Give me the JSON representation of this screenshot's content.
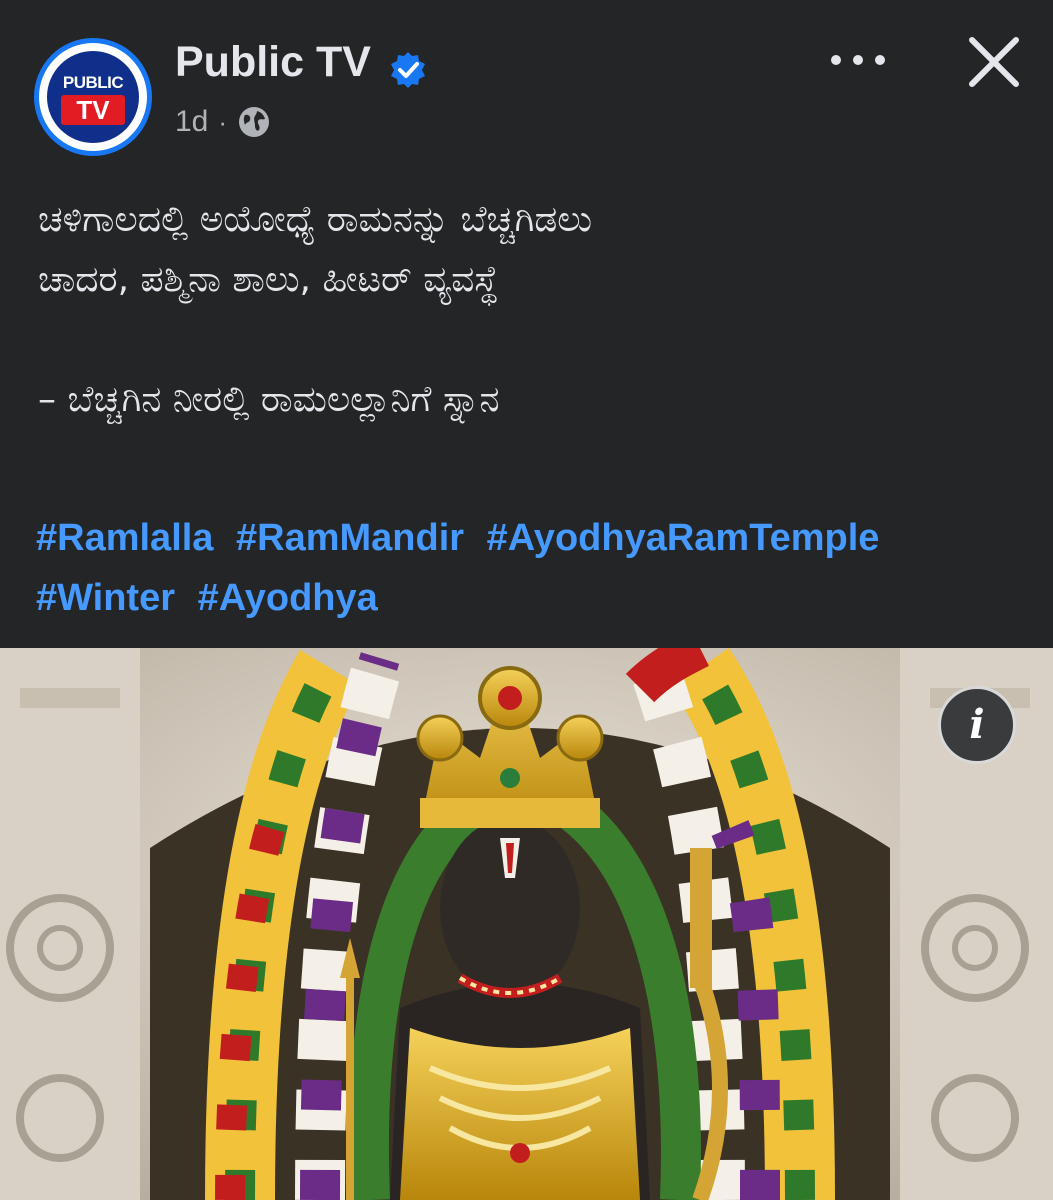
{
  "post": {
    "page_name": "Public TV",
    "avatar_logo_top": "PUBLIC",
    "avatar_logo_bottom": "TV",
    "time": "1d",
    "caption_line1": "ಚಳಿಗಾಲದಲ್ಲಿ ಅಯೋಧ್ಯೆ ರಾಮನನ್ನು ಬೆಚ್ಚಗಿಡಲು",
    "caption_line2": "ಚಾದರ, ಪಶ್ಮಿನಾ ಶಾಲು, ಹೀಟರ್ ವ್ಯವಸ್ಥೆ",
    "caption_line3": "– ಬೆಚ್ಚಗಿನ ನೀರಲ್ಲಿ ರಾಮಲಲ್ಲಾನಿಗೆ ಸ್ನಾನ",
    "hashtags": [
      "#Ramlalla",
      "#RamMandir",
      "#AyodhyaRamTemple",
      "#Winter",
      "#Ayodhya"
    ]
  },
  "icons": {
    "verified": "verified-badge-icon",
    "privacy": "globe-icon",
    "more": "more-options-icon",
    "close": "close-icon",
    "info": "info-icon"
  },
  "info_label": "i",
  "colors": {
    "background": "#242526",
    "text": "#e4e6eb",
    "hashtag": "#4599ff",
    "verified": "#1877f2",
    "logo_red": "#e31b23",
    "logo_blue": "#0f2f8a"
  }
}
